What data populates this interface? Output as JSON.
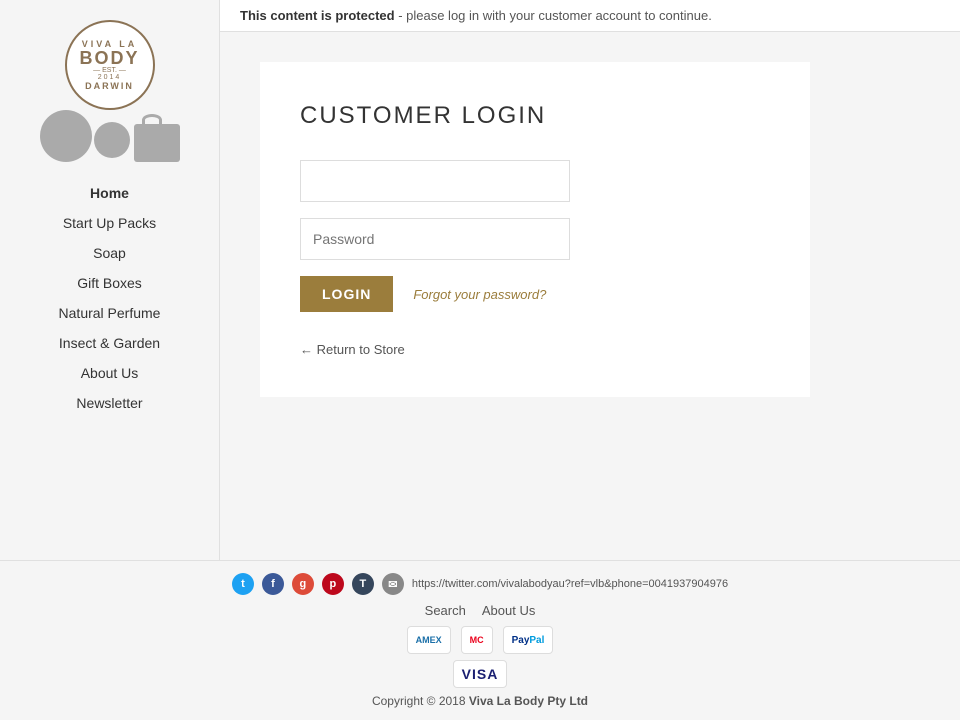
{
  "meta": {
    "title": "Customer Login - Viva La Body"
  },
  "protected_message": {
    "bold": "This content is protected",
    "rest": " - please log in with your customer account to continue."
  },
  "sidebar": {
    "logo_alt": "Viva La Body",
    "logo_lines": {
      "top": "VIVA LA",
      "main": "BODY",
      "est": "EST.",
      "year": "2014",
      "darwin": "DARWIN"
    },
    "nav_items": [
      {
        "label": "Home",
        "active": true
      },
      {
        "label": "Start Up Packs",
        "active": false
      },
      {
        "label": "Soap",
        "active": false
      },
      {
        "label": "Gift Boxes",
        "active": false
      },
      {
        "label": "Natural Perfume",
        "active": false
      },
      {
        "label": "Insect & Garden",
        "active": false
      },
      {
        "label": "About Us",
        "active": false
      },
      {
        "label": "Newsletter",
        "active": false
      }
    ]
  },
  "login_form": {
    "title": "CUSTOMER LOGIN",
    "email_placeholder": "",
    "password_placeholder": "Password",
    "login_button": "LOGIN",
    "forgot_label": "Forgot your password?",
    "return_label": "← Return to Store"
  },
  "footer": {
    "social_url": "https://twitter.com/vivalabodyau?ref=vlb&phone=0041937904976",
    "social_icons": [
      {
        "name": "twitter",
        "symbol": "t"
      },
      {
        "name": "facebook",
        "symbol": "f"
      },
      {
        "name": "google",
        "symbol": "g"
      },
      {
        "name": "pinterest",
        "symbol": "p"
      },
      {
        "name": "tumblr",
        "symbol": "T"
      },
      {
        "name": "email",
        "symbol": "@"
      },
      {
        "name": "extra1",
        "symbol": "+"
      },
      {
        "name": "extra2",
        "symbol": "◼"
      }
    ],
    "links": [
      {
        "label": "Search"
      },
      {
        "label": "About Us"
      }
    ],
    "payment_methods": [
      {
        "name": "amex",
        "label": "AMEX"
      },
      {
        "name": "mastercard",
        "label": "MC"
      },
      {
        "name": "paypal",
        "label": "PayPal"
      },
      {
        "name": "visa",
        "label": "VISA"
      }
    ],
    "copyright": "Copyright © 2018",
    "company_name": "Viva La Body Pty Ltd"
  }
}
